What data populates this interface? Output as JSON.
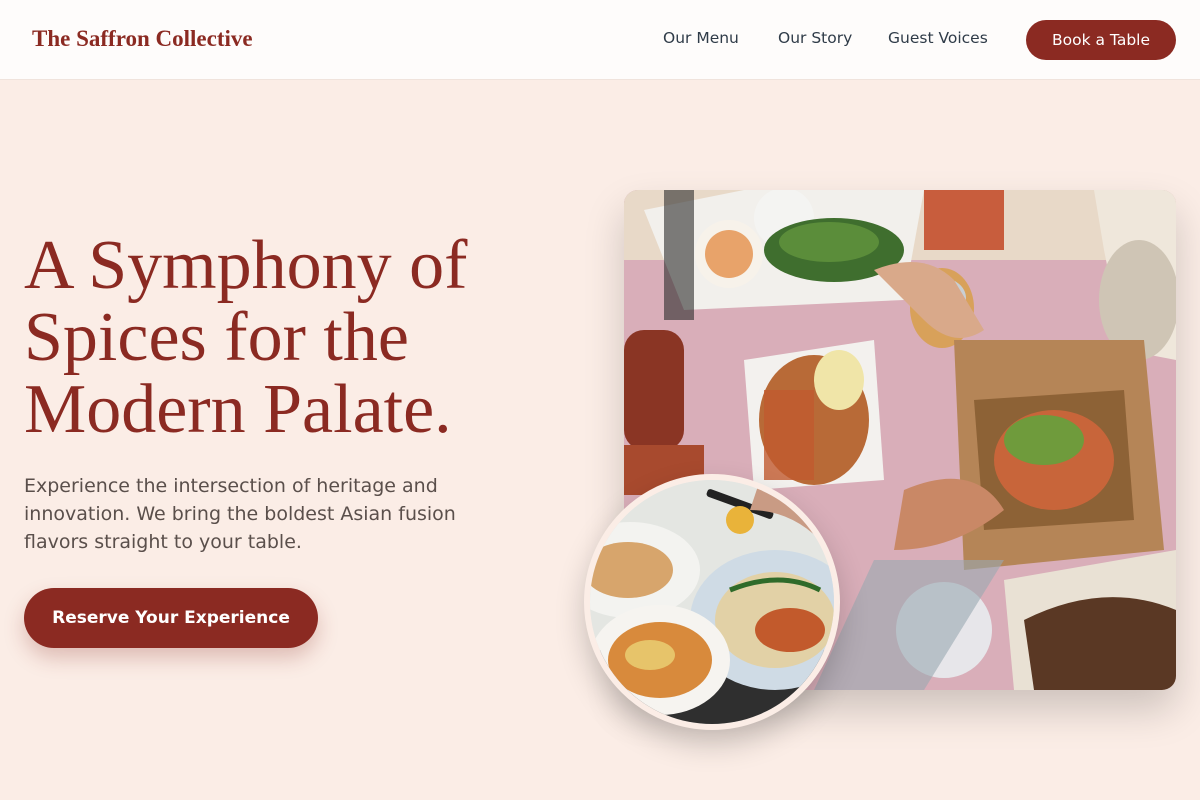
{
  "nav": {
    "brand": "The Saffron Collective",
    "links": [
      "Our Menu",
      "Our Story",
      "Guest Voices"
    ],
    "cta": "Book a Table"
  },
  "hero": {
    "title": "A Symphony of Spices for the Modern Palate.",
    "subtitle": "Experience the intersection of heritage and innovation. We bring the boldest Asian fusion flavors straight to your table.",
    "cta": "Reserve Your Experience"
  },
  "images": {
    "main": "food-spread-photo",
    "inset": "noodle-soup-photo"
  },
  "colors": {
    "brand": "#8b2a22",
    "background": "#fbede6",
    "nav_text": "#2f3b48"
  }
}
